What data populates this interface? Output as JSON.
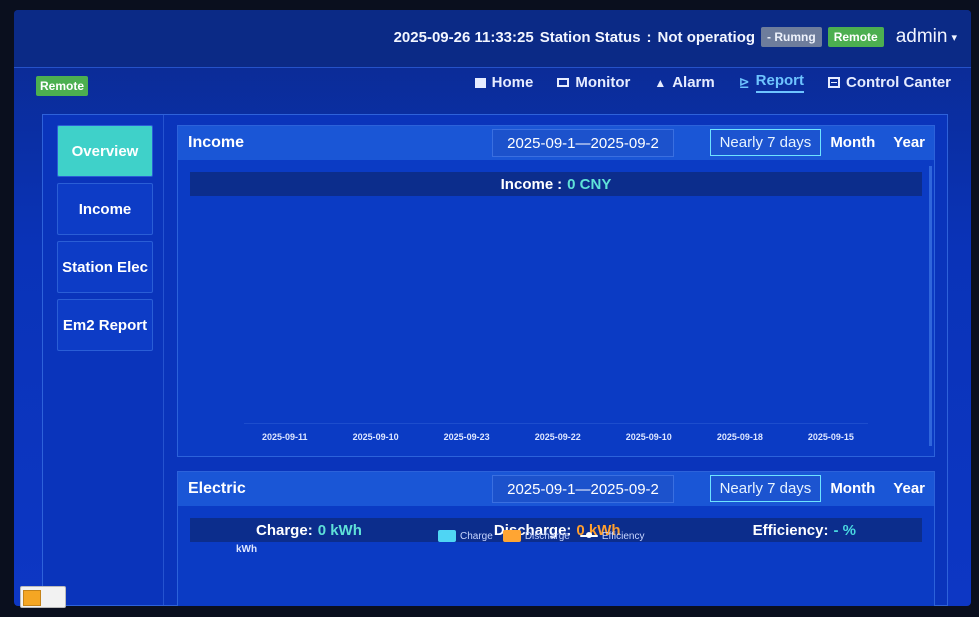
{
  "header": {
    "datetime": "2025-09-26 11:33:25",
    "status_label": "Station Status",
    "status_sep": ":",
    "status_value": "Not operatiog",
    "running_chip": "- Rumng",
    "remote_chip": "Remote",
    "user": "admin",
    "user_caret": "▾"
  },
  "remote_badge": "Remote",
  "nav": [
    {
      "label": "Home",
      "icon": "home-icon"
    },
    {
      "label": "Monitor",
      "icon": "monitor-icon"
    },
    {
      "label": "Alarm",
      "icon": "alarm-icon"
    },
    {
      "label": "Report",
      "icon": "report-icon",
      "active": true
    },
    {
      "label": "Control Canter",
      "icon": "control-center-icon"
    }
  ],
  "sidebar": {
    "items": [
      {
        "label": "Overview",
        "active": true
      },
      {
        "label": "Income"
      },
      {
        "label": "Station Elec"
      },
      {
        "label": "Em2 Report"
      }
    ]
  },
  "income": {
    "title": "Income",
    "date_range": "2025-09-1—2025-09-2",
    "ranges": [
      "Nearly 7 days",
      "Month",
      "Year"
    ],
    "active_range": "Nearly 7 days",
    "summary_label": "Income",
    "summary_sep": ":",
    "summary_value": "0 CNY",
    "x_ticks": [
      "2025-09-11",
      "2025-09-10",
      "2025-09-23",
      "2025-09-22",
      "2025-09-10",
      "2025-09-18",
      "2025-09-15"
    ]
  },
  "electric": {
    "title": "Electric",
    "date_range": "2025-09-1—2025-09-2",
    "ranges": [
      "Nearly 7 days",
      "Month",
      "Year"
    ],
    "active_range": "Nearly 7 days",
    "charge_label": "Charge",
    "charge_value": "0 kWh",
    "discharge_label": "Discharge",
    "discharge_value": "0 kWh",
    "efficiency_label": "Efficiency",
    "efficiency_value": "- %",
    "sep": ":",
    "legend": [
      {
        "label": "Charge",
        "swatch_color": "#4fd5f4"
      },
      {
        "label": "Discharge",
        "swatch_color": "#ffa533"
      },
      {
        "label": "Efficiency"
      }
    ],
    "unit": "kWh"
  },
  "colors": {
    "accent_active": "#3fd1c9",
    "remote_green": "#4caf50",
    "charge_value": "#5fe1d8",
    "discharge_value": "#ff9f2e"
  }
}
